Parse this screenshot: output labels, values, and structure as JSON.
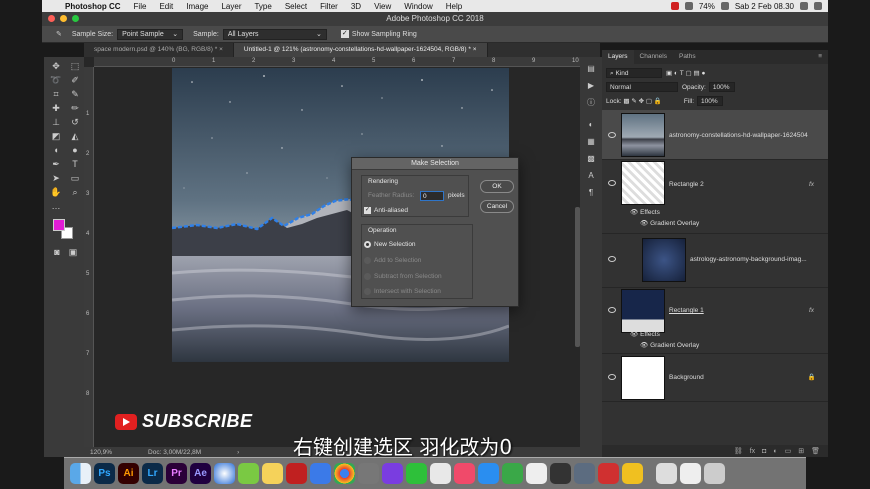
{
  "menubar": {
    "app_name": "Photoshop CC",
    "items": [
      "File",
      "Edit",
      "Image",
      "Layer",
      "Type",
      "Select",
      "Filter",
      "3D",
      "View",
      "Window",
      "Help"
    ],
    "battery": "74%",
    "clock": "Sab 2 Feb  08.30"
  },
  "window": {
    "title": "Adobe Photoshop CC 2018"
  },
  "options": {
    "sample_size_label": "Sample Size:",
    "sample_size_value": "Point Sample",
    "sample_label": "Sample:",
    "sample_value": "All Layers",
    "show_ring_label": "Show Sampling Ring"
  },
  "doc_tabs": [
    "space modern.psd @ 140% (BG, RGB/8) *",
    "Untitled-1 @ 121% (astronomy-constellations-hd-wallpaper-1624504, RGB/8) *"
  ],
  "ruler": {
    "h": [
      "0",
      "1",
      "2",
      "3",
      "4",
      "5",
      "6",
      "7",
      "8",
      "9",
      "10"
    ],
    "v": [
      "1",
      "2",
      "3",
      "4",
      "5",
      "6",
      "7",
      "8"
    ]
  },
  "status": {
    "zoom": "120,9%",
    "doc": "Doc: 3,00M/22,8M"
  },
  "dialog": {
    "title": "Make Selection",
    "rendering_label": "Rendering",
    "feather_label": "Feather Radius:",
    "feather_value": "0",
    "feather_unit": "pixels",
    "anti_aliased": "Anti-aliased",
    "operation_label": "Operation",
    "ops": [
      "New Selection",
      "Add to Selection",
      "Subtract from Selection",
      "Intersect with Selection"
    ],
    "ok": "OK",
    "cancel": "Cancel"
  },
  "layers_panel": {
    "tabs": [
      "Layers",
      "Channels",
      "Paths"
    ],
    "filter": "Kind",
    "blend_mode": "Normal",
    "opacity_label": "Opacity:",
    "opacity": "100%",
    "lock_label": "Lock:",
    "fill_label": "Fill:",
    "fill": "100%",
    "layers": [
      {
        "name": "astronomy-constellations-hd-wallpaper-1624504"
      },
      {
        "name": "Rectangle 2",
        "fx": "fx"
      },
      {
        "name": "astrology-astronomy-background-imag..."
      },
      {
        "name": "Rectangle 1",
        "fx": "fx"
      },
      {
        "name": "Background"
      }
    ],
    "effects_label": "Effects",
    "gradient_overlay": "Gradient Overlay"
  },
  "overlay": {
    "subscribe": "SUBSCRIBE",
    "caption": "右键创建选区 羽化改为0"
  },
  "colors": {
    "foreground": "#e21cd6",
    "background": "#ffffff",
    "selection_path": "#2f80e8"
  },
  "dock": [
    "Finder",
    "Ps",
    "Ai",
    "Lr",
    "Pr",
    "Ae"
  ]
}
